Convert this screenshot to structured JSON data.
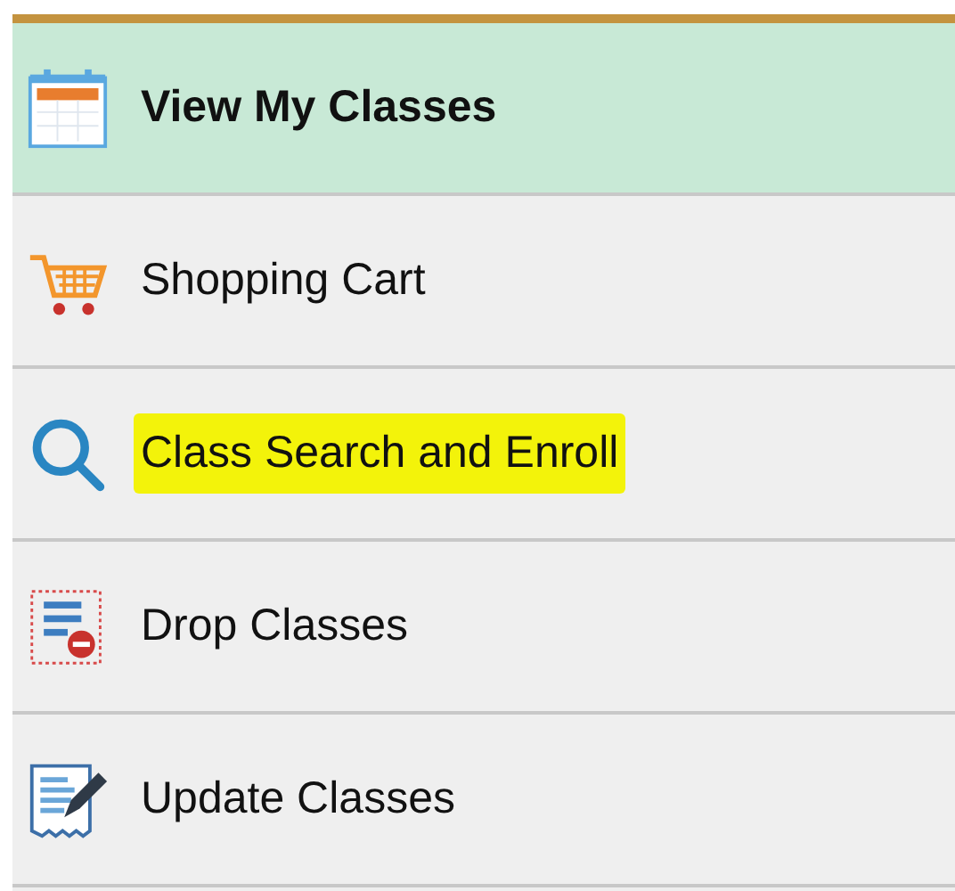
{
  "menu": {
    "items": [
      {
        "label": "View My Classes",
        "kind": "calendar",
        "selected": true,
        "highlighted": false
      },
      {
        "label": "Shopping Cart",
        "kind": "cart",
        "selected": false,
        "highlighted": false
      },
      {
        "label": "Class Search and Enroll",
        "kind": "search",
        "selected": false,
        "highlighted": true
      },
      {
        "label": "Drop Classes",
        "kind": "drop",
        "selected": false,
        "highlighted": false
      },
      {
        "label": "Update Classes",
        "kind": "update",
        "selected": false,
        "highlighted": false
      }
    ]
  }
}
